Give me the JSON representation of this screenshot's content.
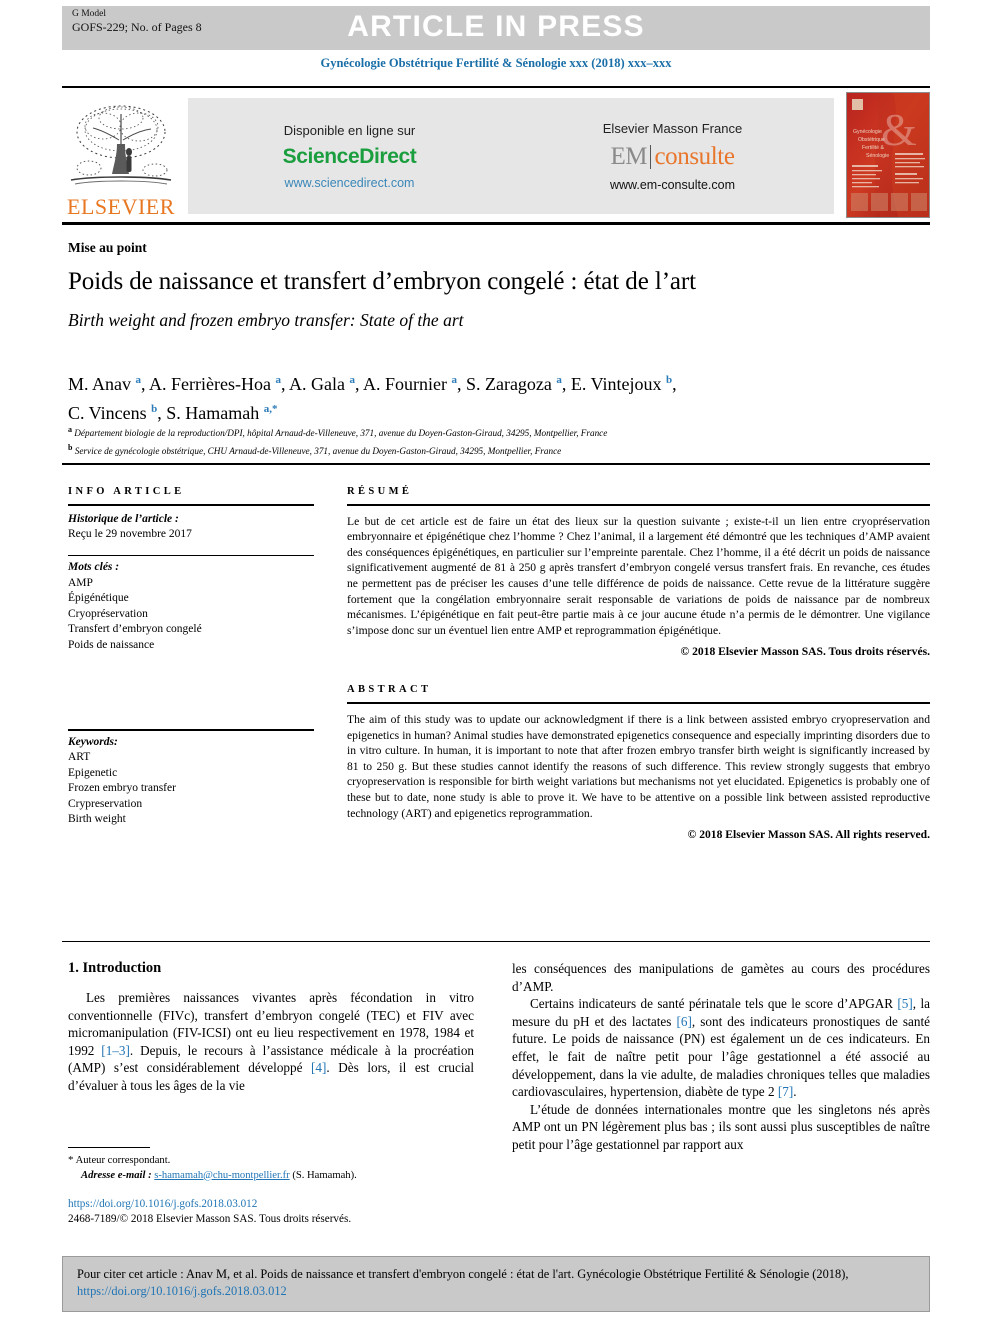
{
  "header": {
    "gmodel_line1": "G Model",
    "gmodel_line2": "GOFS-229; No. of Pages 8",
    "article_in_press": "ARTICLE IN PRESS",
    "journal_line": "Gynécologie Obstétrique Fertilité & Sénologie xxx (2018) xxx–xxx"
  },
  "masthead": {
    "elsevier_wordmark": "ELSEVIER",
    "sciencedirect": {
      "available_label": "Disponible en ligne sur",
      "brand_part1": "Science",
      "brand_part2": "Direct",
      "url": "www.sciencedirect.com"
    },
    "emconsulte": {
      "label": "Elsevier Masson France",
      "brand_part1": "EM",
      "brand_part2": "consulte",
      "url": "www.em-consulte.com"
    },
    "cover_alt": "journal-cover-thumbnail"
  },
  "article": {
    "section_label": "Mise au point",
    "title_fr": "Poids de naissance et transfert d’embryon congelé : état de l’art",
    "title_en": "Birth weight and frozen embryo transfer: State of the art",
    "authors_line1_html": "M. Anav <sup>a</sup>, A. Ferrières-Hoa <sup>a</sup>, A. Gala <sup>a</sup>, A. Fournier <sup>a</sup>, S. Zaragoza <sup>a</sup>, E. Vintejoux <sup>b</sup>,",
    "authors_line2_html": "C. Vincens <sup>b</sup>, S. Hamamah <sup>a,*</sup>",
    "affiliation_a": "Département biologie de la reproduction/DPI, hôpital Arnaud-de-Villeneuve, 371, avenue du Doyen-Gaston-Giraud, 34295, Montpellier, France",
    "affiliation_b": "Service de gynécologie obstétrique, CHU Arnaud-de-Villeneuve, 371, avenue du Doyen-Gaston-Giraud, 34295, Montpellier, France"
  },
  "info_article": {
    "heading": "INFO ARTICLE",
    "history_label": "Historique de l’article :",
    "history_value": "Reçu le 29 novembre 2017",
    "motscles_label": "Mots clés :",
    "motscles": [
      "AMP",
      "Épigénétique",
      "Cryopréservation",
      "Transfert d’embryon congelé",
      "Poids de naissance"
    ],
    "keywords_label": "Keywords:",
    "keywords": [
      "ART",
      "Epigenetic",
      "Frozen embryo transfer",
      "Crypreservation",
      "Birth weight"
    ]
  },
  "resume": {
    "heading": "RÉSUMÉ",
    "text": "Le but de cet article est de faire un état des lieux sur la question suivante ; existe-t-il un lien entre cryopréservation embryonnaire et épigénétique chez l’homme ? Chez l’animal, il a largement été démontré que les techniques d’AMP avaient des conséquences épigénétiques, en particulier sur l’empreinte parentale. Chez l’homme, il a été décrit un poids de naissance significativement augmenté de 81 à 250 g après transfert d’embryon congelé versus transfert frais. En revanche, ces études ne permettent pas de préciser les causes d’une telle différence de poids de naissance. Cette revue de la littérature suggère fortement que la congélation embryonnaire serait responsable de variations de poids de naissance par de nombreux mécanismes. L’épigénétique en fait peut-être partie mais à ce jour aucune étude n’a permis de le démontrer. Une vigilance s’impose donc sur un éventuel lien entre AMP et reprogrammation épigénétique.",
    "copyright": "© 2018 Elsevier Masson SAS. Tous droits réservés."
  },
  "abstract": {
    "heading": "ABSTRACT",
    "text": "The aim of this study was to update our acknowledgment if there is a link between assisted embryo cryopreservation and epigenetics in human? Animal studies have demonstrated epigenetics consequence and especially imprinting disorders due to in vitro culture. In human, it is important to note that after frozen embryo transfer birth weight is significantly increased by 81 to 250 g. But these studies cannot identify the reasons of such difference. This review strongly suggests that embryo cryopreservation is responsible for birth weight variations but mechanisms not yet elucidated. Epigenetics is probably one of these but to date, none study is able to prove it. We have to be attentive on a possible link between assisted reproductive technology (ART) and epigenetics reprogrammation.",
    "copyright": "© 2018 Elsevier Masson SAS. All rights reserved."
  },
  "body": {
    "intro_heading": "1. Introduction",
    "left_para1_html": "Les premières naissances vivantes après fécondation in vitro conventionnelle (FIVc), transfert d’embryon congelé (TEC) et FIV avec micromanipulation (FIV-ICSI) ont eu lieu respectivement en 1978, 1984 et 1992 <span class=\"ref\">[1–3]</span>. Depuis, le recours à l’assistance médicale à la procréation (AMP) s’est considérablement développé <span class=\"ref\">[4]</span>. Dès lors, il est crucial d’évaluer à tous les âges de la vie",
    "right_para_cont_html": "les conséquences des manipulations de gamètes au cours des procédures d’AMP.",
    "right_para2_html": "Certains indicateurs de santé périnatale tels que le score d’APGAR <span class=\"ref\">[5]</span>, la mesure du pH et des lactates <span class=\"ref\">[6]</span>, sont des indicateurs pronostiques de santé future. Le poids de naissance (PN) est également un de ces indicateurs. En effet, le fait de naître petit pour l’âge gestationnel a été associé au développement, dans la vie adulte, de maladies chroniques telles que maladies cardiovasculaires, hypertension, diabète de type 2 <span class=\"ref\">[7]</span>.",
    "right_para3_html": "L’étude de données internationales montre que les singletons nés après AMP ont un PN légèrement plus bas ; ils sont aussi plus susceptibles de naître petit pour l’âge gestationnel par rapport aux"
  },
  "footnote": {
    "star": "*",
    "corresponding": "Auteur correspondant.",
    "email_label": "Adresse e-mail :",
    "email": "s-hamamah@chu-montpellier.fr",
    "email_owner": "(S. Hamamah).",
    "doi": "https://doi.org/10.1016/j.gofs.2018.03.012",
    "issn_line": "2468-7189/© 2018 Elsevier Masson SAS. Tous droits réservés."
  },
  "citation": {
    "text_before": "Pour citer cet article : Anav M, et al. Poids de naissance et transfert d'embryon congelé : état de l'art. Gynécologie Obstétrique Fertilité & Sénologie (2018), ",
    "doi": "https://doi.org/10.1016/j.gofs.2018.03.012"
  },
  "colors": {
    "banner_gray": "#c9c9c9",
    "panel_gray": "#e6e6e6",
    "link_blue": "#1f74b5",
    "journal_blue": "#1a6fa8",
    "elsevier_orange": "#E87722",
    "sciencedirect_green": "#1b9e3e",
    "emconsulte_orange": "#E8762C"
  }
}
